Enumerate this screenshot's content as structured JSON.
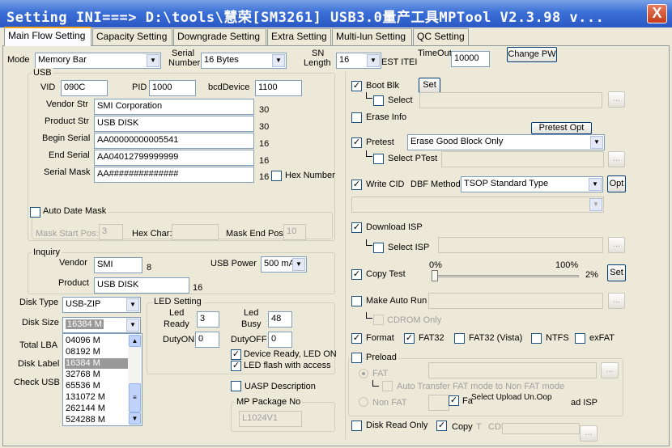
{
  "window": {
    "title": "Setting   INI===> D:\\tools\\慧荣[SM3261] USB3.0量产工具MPTool V2.3.98 v...",
    "close_label": "X"
  },
  "tabs": [
    {
      "label": "Main Flow Setting"
    },
    {
      "label": "Capacity Setting"
    },
    {
      "label": "Downgrade Setting"
    },
    {
      "label": "Extra Setting"
    },
    {
      "label": "Multi-lun Setting"
    },
    {
      "label": "QC Setting"
    }
  ],
  "top": {
    "mode_label": "Mode",
    "mode_value": "Memory Bar",
    "serial_number_label_1": "Serial",
    "serial_number_label_2": "Number",
    "serial_number_value": "16 Bytes",
    "sn_length_label_1": "SN",
    "sn_length_label_2": "Length",
    "sn_length_value": "16",
    "test_item_label": "EST ITEI",
    "timeout_label": "TimeOut",
    "timeout_value": "10000",
    "change_pw_label": "Change PW"
  },
  "usb": {
    "group_label": "USB",
    "vid_label": "VID",
    "vid_value": "090C",
    "pid_label": "PID",
    "pid_value": "1000",
    "bcd_label": "bcdDevice",
    "bcd_value": "1100",
    "vendor_str_label": "Vendor Str",
    "vendor_str_value": "SMI Corporation",
    "vendor_str_len": "30",
    "product_str_label": "Product Str",
    "product_str_value": "USB DISK",
    "product_str_len": "30",
    "begin_serial_label": "Begin Serial",
    "begin_serial_value": "AA00000000005541",
    "begin_serial_len": "16",
    "end_serial_label": "End Serial",
    "end_serial_value": "AA04012799999999",
    "end_serial_len": "16",
    "serial_mask_label": "Serial Mask",
    "serial_mask_value": "AA##############",
    "serial_mask_len": "16",
    "hex_number_label": "Hex Number",
    "auto_date_mask_label": "Auto Date Mask",
    "mask_start_pos_label": "Mask Start Pos:",
    "mask_start_pos_value": "3",
    "hex_char_label": "Hex Char:",
    "hex_char_value": "",
    "mask_end_pos_label": "Mask End Pos:",
    "mask_end_pos_value": "10"
  },
  "inquiry": {
    "group_label": "Inquiry",
    "vendor_label": "Vendor",
    "vendor_value": "SMI",
    "vendor_len": "8",
    "product_label": "Product",
    "product_value": "USB DISK",
    "product_len": "16",
    "usb_power_label": "USB Power",
    "usb_power_value": "500 mA"
  },
  "disk": {
    "disk_type_label": "Disk Type",
    "disk_type_value": "USB-ZIP",
    "disk_size_label": "Disk Size",
    "disk_size_value": "16384 M",
    "total_lba_label": "Total LBA",
    "disk_label_label": "Disk Label",
    "check_usb_label": "Check USB",
    "size_options": [
      "04096 M",
      "08192 M",
      "16384 M",
      "32768 M",
      "65536 M",
      "131072 M",
      "262144 M",
      "524288 M"
    ],
    "selected_index": 2
  },
  "led": {
    "group_label": "LED Setting",
    "led_ready_label_1": "Led",
    "led_ready_label_2": "Ready",
    "led_ready_value": "3",
    "led_busy_label_1": "Led",
    "led_busy_label_2": "Busy",
    "led_busy_value": "48",
    "duty_on_label": "DutyON",
    "duty_on_value": "0",
    "duty_off_label": "DutyOFF",
    "duty_off_value": "0",
    "device_ready_label": "Device Ready, LED ON",
    "led_flash_label": "LED flash with access"
  },
  "uasp_label": "UASP Description",
  "mp_package": {
    "group_label": "MP Package No",
    "value": "L1024V1"
  },
  "right": {
    "boot_blk_label": "Boot Blk",
    "set_label": "Set",
    "select_label": "Select",
    "browse_label": "...",
    "erase_info_label": "Erase Info",
    "pretest_opt_label": "Pretest Opt",
    "pretest_label": "Pretest",
    "pretest_value": "Erase Good Block Only",
    "select_ptest_label": "Select PTest",
    "write_cid_label": "Write CID",
    "dbf_method_label": "DBF Method",
    "dbf_method_value": "TSOP Standard Type",
    "opt_label": "Opt",
    "download_isp_label": "Download ISP",
    "select_isp_label": "Select ISP",
    "copy_test_label": "Copy Test",
    "copy_min": "0%",
    "copy_max": "100%",
    "copy_value": "2%",
    "copy_set_label": "Set",
    "make_auto_run_label": "Make Auto Run",
    "cdrom_only_label": "CDROM Only",
    "format_label": "Format",
    "fat32_label": "FAT32",
    "fat32_vista_label": "FAT32 (Vista)",
    "ntfs_label": "NTFS",
    "exfat_label": "exFAT",
    "preload_label": "Preload",
    "fat_label": "FAT",
    "auto_transfer_label": "Auto Transfer FAT mode to Non FAT mode",
    "non_fat_label": "Non FAT",
    "overlap_text_1": "Fa",
    "overlap_text_2": "Select Upload Un.Oop",
    "overlap_text_3": "ad ISP",
    "disk_read_only_label": "Disk Read Only",
    "copy_label": "Copy",
    "copy_t_label": "T",
    "cdr_label": "CDF"
  }
}
